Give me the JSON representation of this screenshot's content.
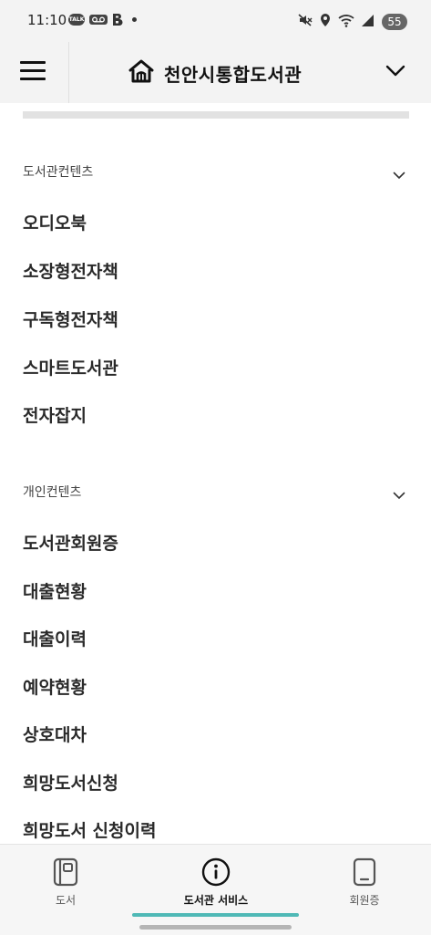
{
  "status_bar": {
    "time": "11:10",
    "talk_badge": "TALK",
    "battery": "55",
    "left_icons": [
      "kakaotalk-icon",
      "voicemail-icon",
      "b-app-icon",
      "notification-dot-icon"
    ],
    "right_icons": [
      "mute-icon",
      "location-icon",
      "wifi-icon",
      "signal-icon",
      "battery-icon"
    ]
  },
  "header": {
    "title": "천안시통합도서관",
    "menu_icon": "hamburger-menu-icon",
    "logo_icon": "library-home-icon",
    "expand_icon": "chevron-down-icon"
  },
  "sections": [
    {
      "title": "도서관컨텐츠",
      "items": [
        "오디오북",
        "소장형전자책",
        "구독형전자책",
        "스마트도서관",
        "전자잡지"
      ]
    },
    {
      "title": "개인컨텐츠",
      "items": [
        "도서관회원증",
        "대출현황",
        "대출이력",
        "예약현황",
        "상호대차",
        "희망도서신청",
        "희망도서 신청이력"
      ]
    }
  ],
  "bottom_nav": {
    "items": [
      {
        "label": "도서",
        "icon": "book-icon"
      },
      {
        "label": "도서관 서비스",
        "icon": "info-icon",
        "active": true
      },
      {
        "label": "회원증",
        "icon": "member-card-icon"
      }
    ],
    "accent_color": "#4fb9b6"
  }
}
